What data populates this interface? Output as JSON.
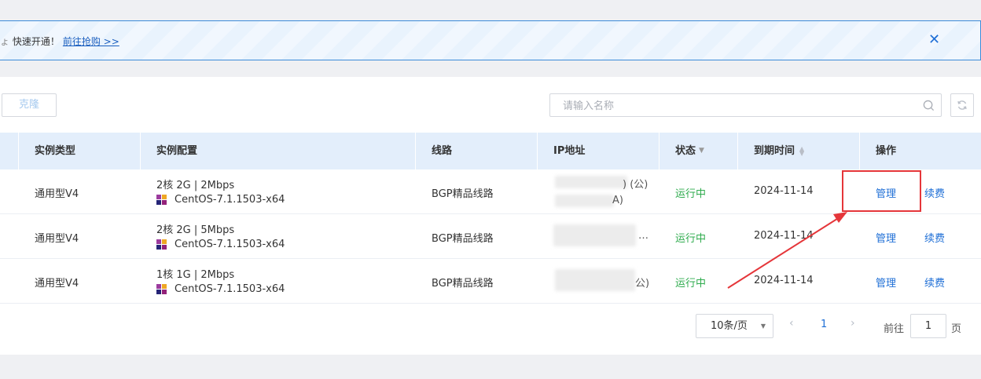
{
  "banner": {
    "text": "快速开通！",
    "link": "前往抢购 >>",
    "close_icon": "close-icon"
  },
  "toolbar": {
    "clone_label": "克隆",
    "search_placeholder": "请输入名称",
    "search_icon": "search-icon",
    "refresh_icon": "refresh-icon"
  },
  "table": {
    "headers": {
      "type": "实例类型",
      "config": "实例配置",
      "line": "线路",
      "ip": "IP地址",
      "status": "状态",
      "expire": "到期时间",
      "actions": "操作"
    },
    "rows": [
      {
        "type": "通用型V4",
        "config": "2核 2G | 2Mbps",
        "os": "CentOS-7.1.1503-x64",
        "line": "BGP精品线路",
        "ip_line1_suffix": ") (公)",
        "ip_line2_suffix": "A)",
        "status": "运行中",
        "expire": "2024-11-14",
        "manage": "管理",
        "renew": "续费"
      },
      {
        "type": "通用型V4",
        "config": "2核 2G | 5Mbps",
        "os": "CentOS-7.1.1503-x64",
        "line": "BGP精品线路",
        "ip_line1_suffix": "",
        "ip_line2_suffix": "…",
        "status": "运行中",
        "expire": "2024-11-14",
        "manage": "管理",
        "renew": "续费"
      },
      {
        "type": "通用型V4",
        "config": "1核 1G | 2Mbps",
        "os": "CentOS-7.1.1503-x64",
        "line": "BGP精品线路",
        "ip_line1_suffix": "公)",
        "ip_line2_suffix": "",
        "status": "运行中",
        "expire": "2024-11-14",
        "manage": "管理",
        "renew": "续费"
      }
    ]
  },
  "pagination": {
    "page_size": "10条/页",
    "current_page": "1",
    "goto_label": "前往",
    "goto_value": "1",
    "page_unit": "页"
  },
  "colors": {
    "accent": "#1f6fd6",
    "status_running": "#2eab4d",
    "annotation_red": "#e5363a"
  }
}
